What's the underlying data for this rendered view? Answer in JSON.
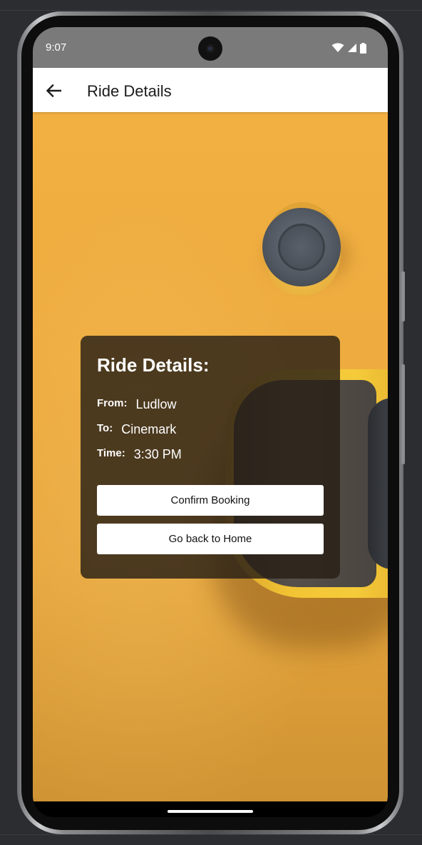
{
  "status_bar": {
    "time": "9:07",
    "icons": [
      "wifi-icon",
      "signal-icon",
      "battery-icon"
    ]
  },
  "app_bar": {
    "back_icon": "arrow-left-icon",
    "title": "Ride Details"
  },
  "card": {
    "title": "Ride Details:",
    "from_label": "From:",
    "from_value": "Ludlow",
    "to_label": "To:",
    "to_value": "Cinemark",
    "time_label": "Time:",
    "time_value": "3:30 PM",
    "confirm_button": "Confirm Booking",
    "home_button": "Go back to Home"
  },
  "colors": {
    "background_accent": "#f0ad40",
    "card_background": "#281e16",
    "app_bar": "#ffffff",
    "status_bar": "#7a7a7a"
  }
}
